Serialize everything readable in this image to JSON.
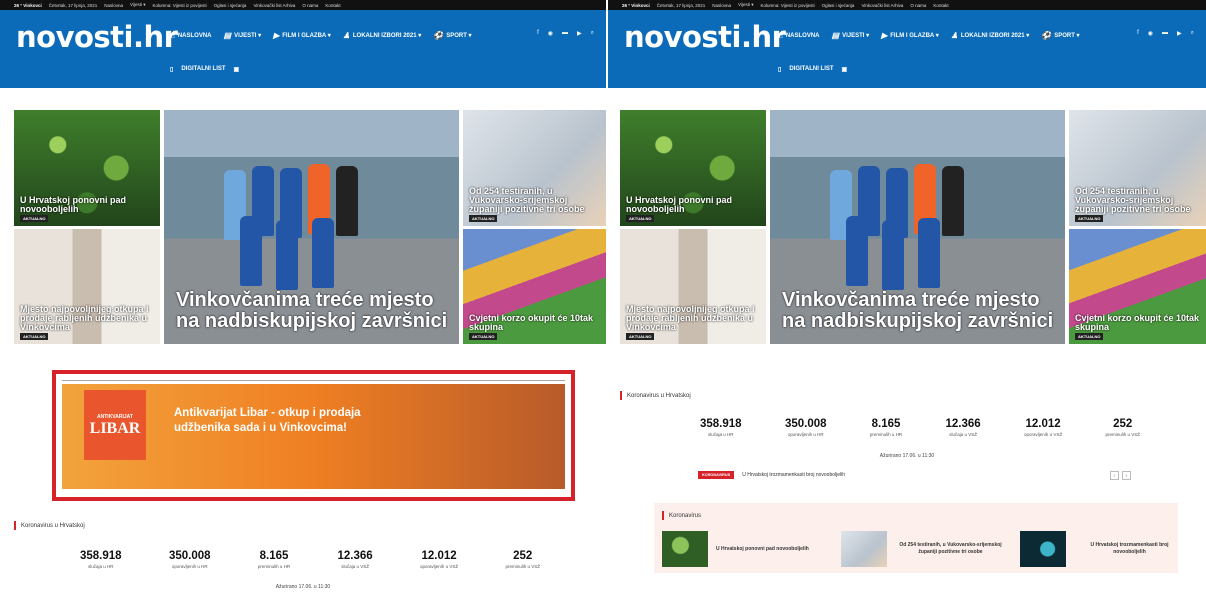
{
  "topbar": {
    "weather": "26 °  Vinkovci",
    "date": "Četvrtak, 17 lipnja, 2021",
    "links": [
      "Naslovna",
      "Vijesti ▾",
      "Kolumna: Vijesti iz povijesti",
      "Oglasi i sjećanja",
      "Vinkovački list Arhiva",
      "O nama",
      "Kontakt"
    ]
  },
  "header": {
    "logo": "novosti.hr",
    "nav": [
      {
        "icon": "⌂",
        "label": "NASLOVNA"
      },
      {
        "icon": "▤",
        "label": "VIJESTI ▾"
      },
      {
        "icon": "▶",
        "label": "FILM I GLAZBA ▾"
      },
      {
        "icon": "♟",
        "label": "LOKALNI IZBORI 2021 ▾"
      },
      {
        "icon": "⚽",
        "label": "SPORT ▾"
      }
    ],
    "social": [
      "f",
      "◉",
      "▬",
      "▶",
      "⌕"
    ],
    "nav2": {
      "icon": "▯",
      "label": "DIGITALNI LIST",
      "icon2": "▣"
    }
  },
  "tiles": {
    "t1": {
      "caption": "U Hrvatskoj ponovni pad novooboljelih",
      "badge": "AKTUALNO"
    },
    "t2": {
      "caption": "Mjesto najpovoljnijeg otkupa i prodaje rabljenih udžbenika u Vinkovcima",
      "badge": "AKTUALNO"
    },
    "t3": {
      "caption": "Vinkovčanima treće mjesto na nadbiskupijskoj završnici"
    },
    "t4": {
      "caption": "Od 254 testiranih, u Vukovarsko-srijemskoj županiji pozitivne tri osobe",
      "badge": "AKTUALNO"
    },
    "t5": {
      "caption": "Cvjetni korzo okupit će 10tak skupina",
      "badge": "AKTUALNO"
    }
  },
  "ad": {
    "brand_small": "ANTIKVARIJAT",
    "brand_big": "LIBAR",
    "text": "Antikvarijat Libar - otkup i prodaja udžbenika sada i u Vinkovcima!"
  },
  "corona": {
    "title": "Koronavirus u Hrvatskoj",
    "stats": [
      {
        "num": "358.918",
        "label": "slučaja u HR"
      },
      {
        "num": "350.008",
        "label": "oporavljenih u HR"
      },
      {
        "num": "8.165",
        "label": "preminulih u HR"
      },
      {
        "num": "12.366",
        "label": "slučaja u VSŽ"
      },
      {
        "num": "12.012",
        "label": "oporavljenih u VSŽ"
      },
      {
        "num": "252",
        "label": "preminulih u VSŽ"
      }
    ],
    "updated": "Ažurirano 17.06. u 11:30",
    "ticker_tag": "KORONAVIRUS",
    "ticker_text": "U Hrvatskoj trozmamenkasti broj novooboljelih"
  },
  "corona_box": {
    "title": "Koronavirus",
    "items": [
      {
        "text": "U Hrvatskoj ponovni pad novooboljelih"
      },
      {
        "text": "Od 254 testiranih, u Vukovarsko-srijemskoj županiji pozitivne tri osobe"
      },
      {
        "text": "U Hrvatskoj trozmamenkasti broj novooboljelih"
      }
    ]
  }
}
